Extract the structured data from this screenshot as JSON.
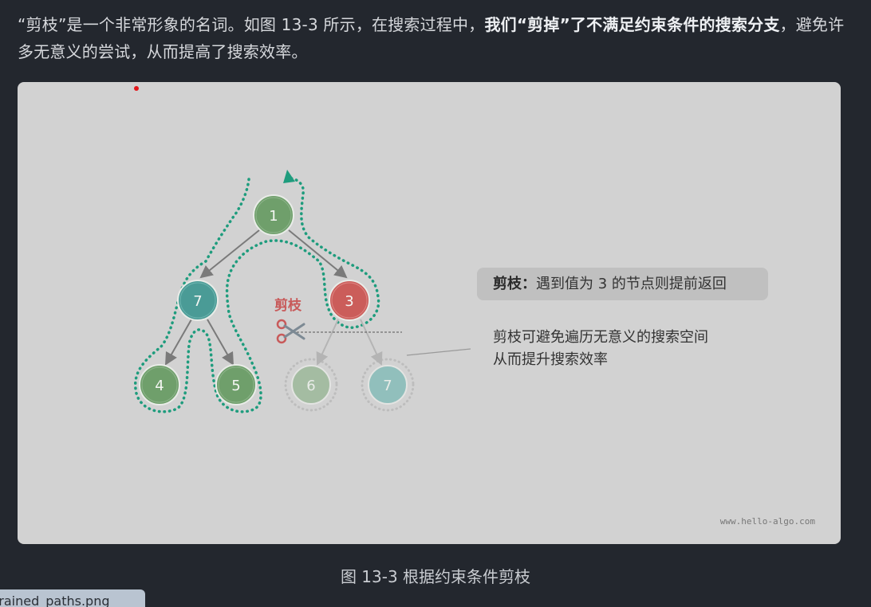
{
  "paragraph": {
    "part1": "“剪枝”是一个非常形象的名词。如图 13-3 所示，在搜索过程中，",
    "bold": "我们“剪掉”了不满足约束条件的搜索分支",
    "part2": "，避免许多无意义的尝试，从而提高了搜索效率。"
  },
  "figure": {
    "nodes": {
      "root": "1",
      "left": "7",
      "right": "3",
      "ll": "4",
      "lr": "5",
      "rl": "6",
      "rr": "7"
    },
    "prune_label": "剪枝",
    "callout_bold": "剪枝：",
    "callout_text": "遇到值为  3  的节点则提前返回",
    "note_line1": "剪枝可避免遍历无意义的搜索空间",
    "note_line2": "从而提升搜索效率",
    "watermark": "www.hello-algo.com",
    "colors": {
      "green_node": "#6f9f6b",
      "teal_node": "#4a9b96",
      "red_node": "#cb5d5a",
      "path_dots": "#1e9c7d",
      "background": "#d2d2d2"
    }
  },
  "caption": "图 13-3   根据约束条件剪枝",
  "file_tab": "trained_paths.png"
}
